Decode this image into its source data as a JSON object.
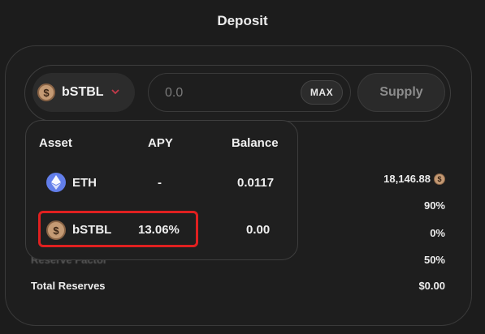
{
  "title": "Deposit",
  "selector": {
    "token": "bSTBL",
    "coin_glyph": "$"
  },
  "amount": {
    "placeholder": "0.0",
    "max_label": "MAX"
  },
  "supply_label": "Supply",
  "stats": {
    "liquidity_value": "18,146.88",
    "ltv_value": "90%",
    "rate_value": "0%",
    "reserve_factor_label": "Reserve Factor",
    "reserve_factor_value": "50%",
    "total_reserves_label": "Total Reserves",
    "total_reserves_value": "$0.00"
  },
  "dropdown": {
    "headers": {
      "asset": "Asset",
      "apy": "APY",
      "balance": "Balance"
    },
    "rows": [
      {
        "asset": "ETH",
        "apy": "-",
        "balance": "0.0117",
        "icon": "eth-icon"
      },
      {
        "asset": "bSTBL",
        "apy": "13.06%",
        "balance": "0.00",
        "icon": "bstbl-coin-icon"
      }
    ]
  },
  "colors": {
    "background": "#1c1c1c",
    "coin": "#c49a74",
    "eth": "#627eea",
    "highlight": "#e02020",
    "chevron": "#c23a4a"
  }
}
